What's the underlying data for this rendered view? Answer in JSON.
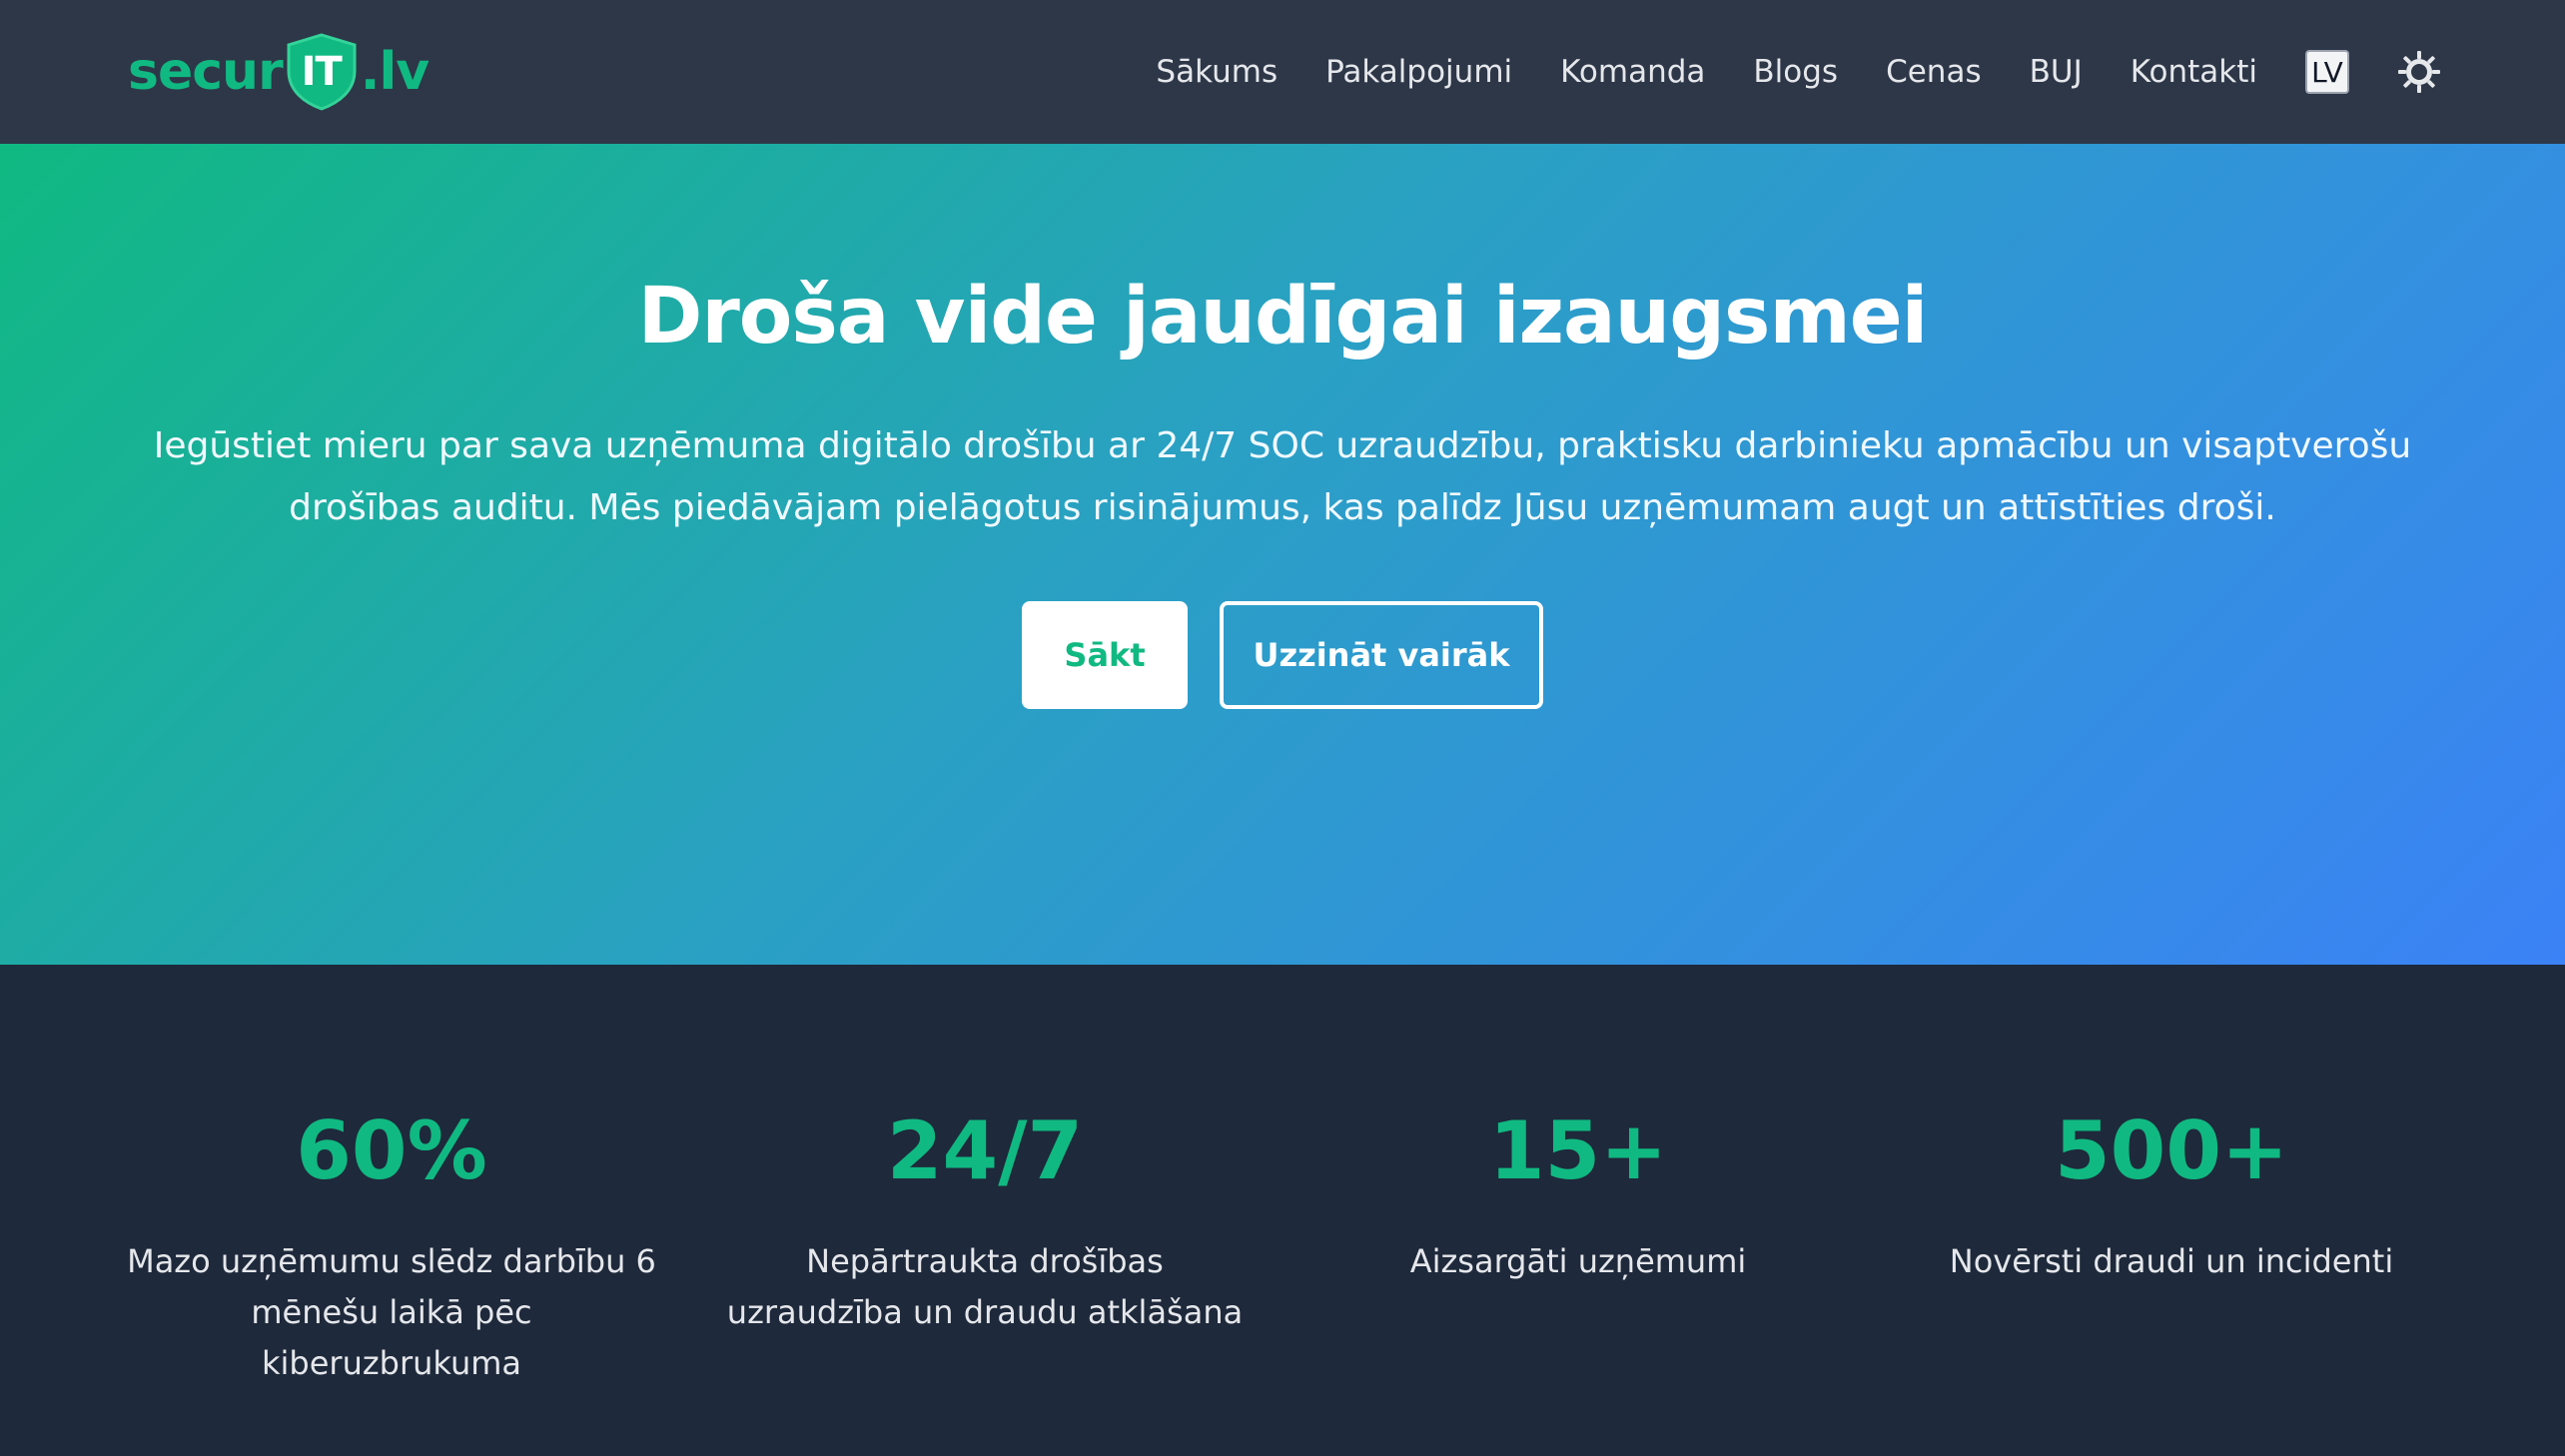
{
  "brand": {
    "logo_left": "secur",
    "logo_shield": "IT",
    "logo_right": ".lv",
    "accent_color": "#10b981"
  },
  "nav": {
    "links": [
      "Sākums",
      "Pakalpojumi",
      "Komanda",
      "Blogs",
      "Cenas",
      "BUJ",
      "Kontakti"
    ],
    "language": "LV",
    "theme_icon": "sun-icon"
  },
  "hero": {
    "title": "Droša vide jaudīgai izaugsmei",
    "subtitle": "Iegūstiet mieru par sava uzņēmuma digitālo drošību ar 24/7 SOC uzraudzību, praktisku darbinieku apmācību un visaptverošu drošības auditu. Mēs piedāvājam pielāgotus risinājumus, kas palīdz Jūsu uzņēmumam augt un attīstīties droši.",
    "primary_button": "Sākt",
    "secondary_button": "Uzzināt vairāk",
    "gradient_start": "#10b981",
    "gradient_end": "#3b82f6"
  },
  "stats": [
    {
      "value": "60%",
      "label": "Mazo uzņēmumu slēdz darbību 6 mēnešu laikā pēc kiberuzbrukuma"
    },
    {
      "value": "24/7",
      "label": "Nepārtraukta drošības uzraudzība un draudu atklāšana"
    },
    {
      "value": "15+",
      "label": "Aizsargāti uzņēmumi"
    },
    {
      "value": "500+",
      "label": "Novērsti draudi un incidenti"
    }
  ]
}
